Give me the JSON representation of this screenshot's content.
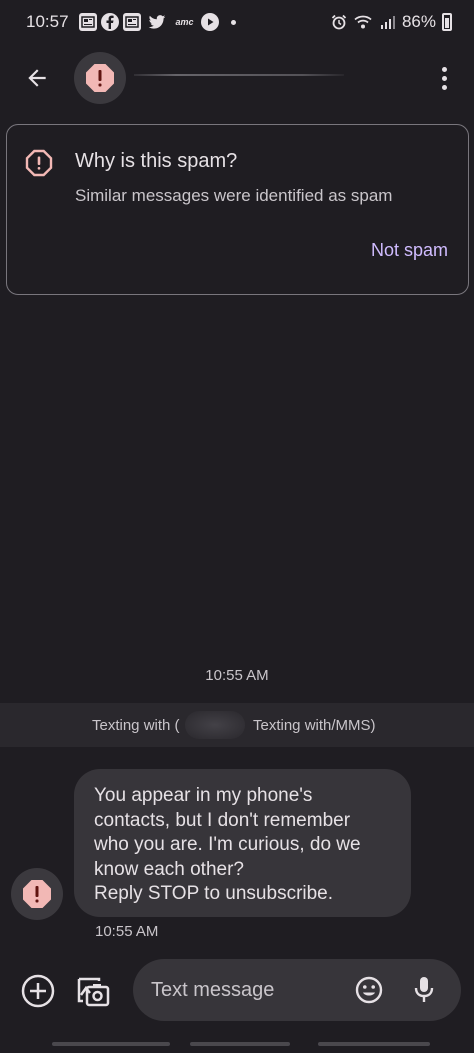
{
  "status_bar": {
    "time": "10:57",
    "notification_icons": [
      "news-icon",
      "facebook-icon",
      "news-icon",
      "twitter-icon",
      "amc-icon",
      "play-icon"
    ],
    "amc_text": "amc",
    "battery": "86%"
  },
  "app_bar": {
    "back_icon": "arrow-left-icon",
    "avatar_icon": "spam-warning-icon",
    "more_icon": "more-vert-icon"
  },
  "spam_card": {
    "title": "Why is this spam?",
    "subtitle": "Similar messages were identified as spam",
    "action_label": "Not spam"
  },
  "conversation": {
    "time_divider": "10:55 AM",
    "texting_with_left": "Texting with (",
    "texting_with_right": "Texting with/MMS)",
    "message": {
      "lines": [
        "You appear in my phone's",
        "contacts, but I don't remember",
        "who you are. I'm curious, do we",
        "know each other?",
        "Reply STOP to unsubscribe."
      ],
      "time": "10:55 AM"
    }
  },
  "compose": {
    "placeholder": "Text message"
  },
  "colors": {
    "background": "#1f1d22",
    "bubble": "#37353a",
    "accent": "#d0bcff",
    "spam_red": "#f2b8b5"
  }
}
